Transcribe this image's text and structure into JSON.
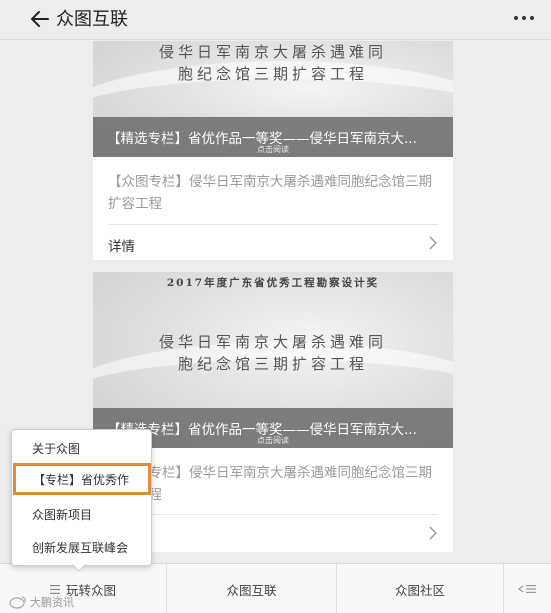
{
  "header": {
    "title": "众图互联"
  },
  "cards": [
    {
      "banner_lines": [
        "侵华日军南京大屠杀遇难同",
        "胞纪念馆三期扩容工程"
      ],
      "overlay_title": "【精选专栏】省优作品一等奖——侵华日军南京大...",
      "overlay_hint": "点击阅读",
      "description": "【众图专栏】侵华日军南京大屠杀遇难同胞纪念馆三期扩容工程",
      "detail_label": "详情"
    },
    {
      "award_line": "2017年度广东省优秀工程勘察设计奖",
      "banner_lines": [
        "侵华日军南京大屠杀遇难同",
        "胞纪念馆三期扩容工程"
      ],
      "overlay_title": "【精选专栏】省优作品一等奖——侵华日军南京大...",
      "overlay_hint": "点击阅读",
      "description": "【众图专栏】侵华日军南京大屠杀遇难同胞纪念馆三期扩容工程"
    }
  ],
  "popup_menu": {
    "items": [
      {
        "label": "关于众图",
        "highlighted": false
      },
      {
        "label": "【专栏】省优秀作",
        "highlighted": true
      },
      {
        "label": "众图新项目",
        "highlighted": false
      },
      {
        "label": "创新发展互联峰会",
        "highlighted": false
      }
    ],
    "highlight_color": "#e08a3c"
  },
  "bottom_nav": {
    "items": [
      {
        "label": "玩转众图",
        "icon": "menu-icon"
      },
      {
        "label": "众图互联"
      },
      {
        "label": "众图社区"
      }
    ],
    "keyboard_icon": "keyboard-icon"
  },
  "watermark": {
    "text": "大鹏资讯"
  },
  "icons": {
    "back": "arrow-left-icon",
    "more": "more-dots-icon",
    "chevron": "chevron-right-icon"
  }
}
